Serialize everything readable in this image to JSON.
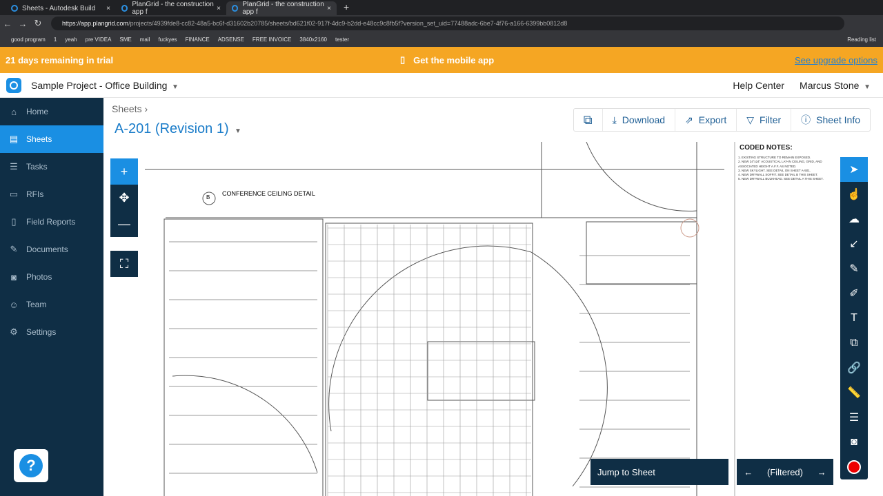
{
  "browser": {
    "tabs": [
      {
        "label": "Sheets - Autodesk Build"
      },
      {
        "label": "PlanGrid - the construction app f"
      },
      {
        "label": "PlanGrid - the construction app f"
      }
    ],
    "url_host": "https://app.plangrid.com",
    "url_path": "/projects/4939fde8-cc82-48a5-bc6f-d31602b20785/sheets/bd621f02-917f-4dc9-b2dd-e48cc9c8fb5f?version_set_uid=77488adc-6be7-4f76-a166-6399bb0812d8",
    "bookmarks": [
      "good program",
      "1",
      "yeah",
      "pre VIDEA",
      "SME",
      "mail",
      "fuckyes",
      "FINANCE",
      "ADSENSE",
      "FREE INVOICE",
      "3840x2160",
      "tester"
    ],
    "reading_list": "Reading list"
  },
  "trial": {
    "remaining": "21 days remaining in trial",
    "mobile": "Get the mobile app",
    "upgrade": "See upgrade options"
  },
  "header": {
    "project": "Sample Project - Office Building",
    "help": "Help Center",
    "user": "Marcus Stone"
  },
  "sidebar": {
    "items": [
      {
        "label": "Home",
        "icon": "⌂"
      },
      {
        "label": "Sheets",
        "icon": "▤"
      },
      {
        "label": "Tasks",
        "icon": "☰"
      },
      {
        "label": "RFIs",
        "icon": "▭"
      },
      {
        "label": "Field Reports",
        "icon": "▯"
      },
      {
        "label": "Documents",
        "icon": "✎"
      },
      {
        "label": "Photos",
        "icon": "◙"
      },
      {
        "label": "Team",
        "icon": "☺"
      },
      {
        "label": "Settings",
        "icon": "⚙"
      }
    ]
  },
  "main": {
    "breadcrumb": "Sheets",
    "sheet_title": "A-201 (Revision 1)",
    "toolbar": {
      "download": "Download",
      "export": "Export",
      "filter": "Filter",
      "sheet_info": "Sheet Info"
    },
    "drawing": {
      "detail_tag": "B",
      "detail_title": "CONFERENCE CEILING DETAIL",
      "notes_title": "CODED NOTES:",
      "notes": [
        "1. EXISTING STRUCTURE TO REMAIN EXPOSED.",
        "2. NEW 24\"x24\" ACOUSTICAL LAY-IN CEILING, GRID, AND ASSOCIATED HEIGHT A.F.F. AS NOTED.",
        "3. NEW SKYLIGHT. SEE DETAIL ON SHEET A-501.",
        "4. NEW DRYWALL SOFFIT. SEE DETAIL B THIS SHEET.",
        "5. NEW DRYWALL BULKHEAD. SEE DETAIL A THIS SHEET."
      ]
    },
    "jump_to_sheet": "Jump to Sheet",
    "filtered": "(Filtered)"
  },
  "colors": {
    "accent": "#1a8fe3",
    "sidebar": "#0f2e45",
    "trial": "#f5a623"
  }
}
